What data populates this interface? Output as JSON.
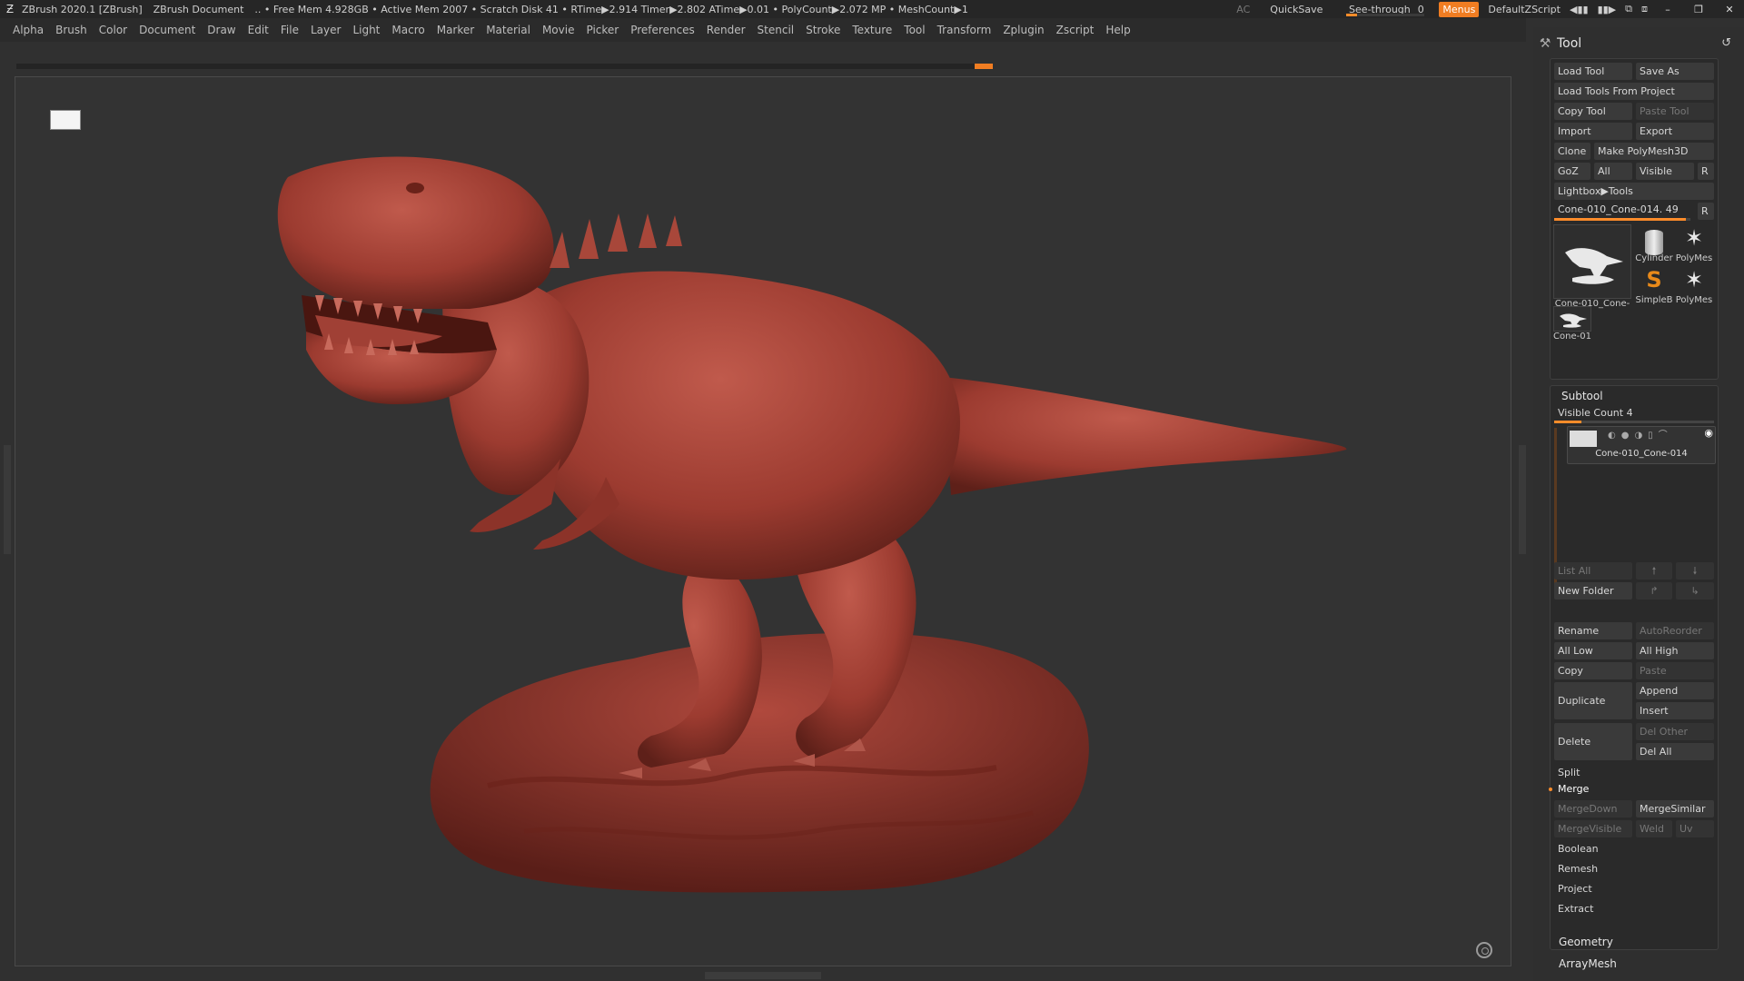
{
  "titlebar": {
    "app": "ZBrush 2020.1 [ZBrush]",
    "document": "ZBrush Document",
    "stats": ".. • Free Mem 4.928GB • Active Mem 2007 • Scratch Disk 41 • RTime▶2.914 Timer▶2.802 ATime▶0.01 • PolyCount▶2.072 MP • MeshCount▶1",
    "ac": "AC",
    "quicksave": "QuickSave",
    "seethrough_label": "See-through",
    "seethrough_value": "0",
    "menus": "Menus",
    "script": "DefaultZScript"
  },
  "menu": [
    "Alpha",
    "Brush",
    "Color",
    "Document",
    "Draw",
    "Edit",
    "File",
    "Layer",
    "Light",
    "Macro",
    "Marker",
    "Material",
    "Movie",
    "Picker",
    "Preferences",
    "Render",
    "Stencil",
    "Stroke",
    "Texture",
    "Tool",
    "Transform",
    "Zplugin",
    "Zscript",
    "Help"
  ],
  "tool_panel": {
    "title": "Tool",
    "load_tool": "Load Tool",
    "save_as": "Save As",
    "load_from_project": "Load Tools From Project",
    "copy_tool": "Copy Tool",
    "paste_tool": "Paste Tool",
    "import": "Import",
    "export": "Export",
    "clone": "Clone",
    "make_polymesh": "Make PolyMesh3D",
    "goz": "GoZ",
    "all": "All",
    "visible": "Visible",
    "r": "R",
    "lightbox": "Lightbox▶Tools",
    "current_tool": "Cone-010_Cone-014. 49",
    "thumbs": {
      "main": "Cone-010_Cone-",
      "cylinder": "Cylinder",
      "polymesh1": "PolyMes",
      "simpleb": "SimpleB",
      "polymesh2": "PolyMes",
      "small": "Cone-01"
    }
  },
  "subtool": {
    "title": "Subtool",
    "visible_count": "Visible Count 4",
    "item": "Cone-010_Cone-014",
    "list_all": "List All",
    "new_folder": "New Folder",
    "rename": "Rename",
    "auto_reorder": "AutoReorder",
    "all_low": "All Low",
    "all_high": "All High",
    "copy": "Copy",
    "paste": "Paste",
    "duplicate": "Duplicate",
    "append": "Append",
    "insert": "Insert",
    "delete": "Delete",
    "del_other": "Del Other",
    "del_all": "Del All",
    "split": "Split",
    "merge": "Merge",
    "merge_down": "MergeDown",
    "merge_similar": "MergeSimilar",
    "merge_visible": "MergeVisible",
    "weld": "Weld",
    "uv": "Uv",
    "boolean": "Boolean",
    "remesh": "Remesh",
    "project": "Project",
    "extract": "Extract"
  },
  "sections": {
    "geometry": "Geometry",
    "arraymesh": "ArrayMesh"
  },
  "colors": {
    "accent": "#f07d22",
    "model": "#9e3d32"
  }
}
